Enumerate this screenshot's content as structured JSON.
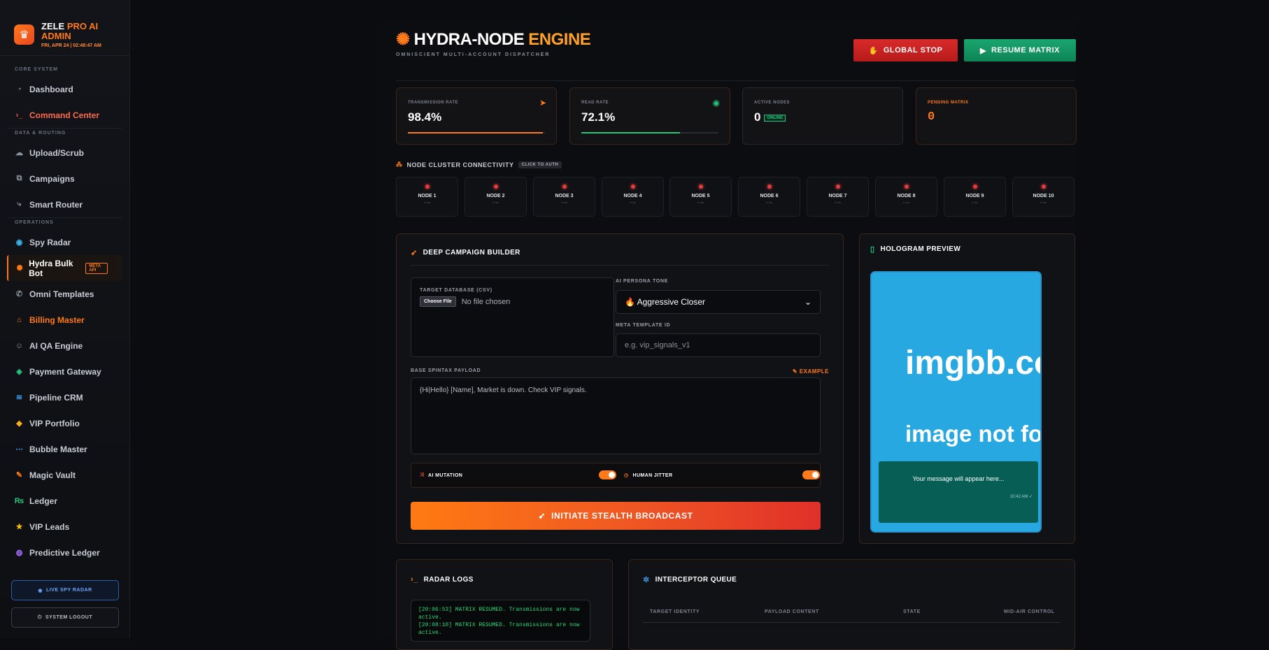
{
  "brand": {
    "name_a": "ZELE",
    "name_b": "PRO AI",
    "name_c": "ADMIN",
    "datetime": "FRI, APR 24 | 02:48:47 AM"
  },
  "sidebar": {
    "sec_core": "CORE SYSTEM",
    "sec_data": "DATA & ROUTING",
    "sec_ops": "OPERATIONS",
    "items": [
      {
        "label": "Dashboard"
      },
      {
        "label": "Command Center"
      },
      {
        "label": "Upload/Scrub"
      },
      {
        "label": "Campaigns"
      },
      {
        "label": "Smart Router"
      },
      {
        "label": "Spy Radar"
      },
      {
        "label": "Hydra Bulk Bot"
      },
      {
        "label": "Omni Templates"
      },
      {
        "label": "Billing Master"
      },
      {
        "label": "AI QA Engine"
      },
      {
        "label": "Payment Gateway"
      },
      {
        "label": "Pipeline CRM"
      },
      {
        "label": "VIP Portfolio"
      },
      {
        "label": "Bubble Master"
      },
      {
        "label": "Magic Vault"
      },
      {
        "label": "Ledger"
      },
      {
        "label": "VIP Leads"
      },
      {
        "label": "Predictive Ledger"
      }
    ],
    "hydra_badge": "META API",
    "live_btn": "LIVE SPY RADAR",
    "logout_btn": "SYSTEM LOGOUT"
  },
  "header": {
    "title_a": "HYDRA-NODE",
    "title_b": "ENGINE",
    "subtitle": "OMNISCIENT MULTI-ACCOUNT DISPATCHER",
    "stop": "GLOBAL STOP",
    "resume": "RESUME MATRIX"
  },
  "stats": [
    {
      "label": "TRANSMISSION RATE",
      "value": "98.4%",
      "fill": 0.984
    },
    {
      "label": "READ RATE",
      "value": "72.1%",
      "fill": 0.721
    },
    {
      "label": "ACTIVE NODES",
      "value": "0",
      "tag": "ONLINE"
    },
    {
      "label": "PENDING MATRIX",
      "value": "0"
    }
  ],
  "cluster": {
    "title": "NODE CLUSTER CONNECTIVITY",
    "chip": "CLICK TO AUTH",
    "nodes": [
      "NODE 1",
      "NODE 2",
      "NODE 3",
      "NODE 4",
      "NODE 5",
      "NODE 6",
      "NODE 7",
      "NODE 8",
      "NODE 9",
      "NODE 10"
    ],
    "ms": "0 ms"
  },
  "builder": {
    "title": "DEEP CAMPAIGN BUILDER",
    "db_label": "TARGET DATABASE (CSV)",
    "choose": "Choose File",
    "no_file": "No file chosen",
    "tone_label": "AI PERSONA TONE",
    "tone_value": "🔥 Aggressive Closer",
    "tmpl_label": "META TEMPLATE ID",
    "tmpl_placeholder": "e.g. vip_signals_v1",
    "payload_label": "BASE SPINTAX PAYLOAD",
    "example": "EXAMPLE",
    "payload": "{Hi|Hello} [Name], Market is down. Check VIP signals.",
    "mutation": "AI MUTATION",
    "jitter": "HUMAN JITTER",
    "cta": "INITIATE STEALTH BROADCAST"
  },
  "preview": {
    "title": "HOLOGRAM PREVIEW",
    "img1": "imgbb.com",
    "img2": "image not found",
    "msg": "Your message will appear here...",
    "time": "10:42 AM ✓"
  },
  "logs": {
    "title": "RADAR LOGS",
    "lines": [
      "[20:06:53] MATRIX RESUMED. Transmissions are now active.",
      "[20:08:10] MATRIX RESUMED. Transmissions are now active."
    ]
  },
  "queue": {
    "title": "INTERCEPTOR QUEUE",
    "cols": [
      "TARGET IDENTITY",
      "PAYLOAD CONTENT",
      "STATE",
      "MID-AIR CONTROL"
    ]
  },
  "colors": {
    "accent": "#ff7a1a",
    "danger": "#d92a2a",
    "success": "#1aa66e"
  }
}
